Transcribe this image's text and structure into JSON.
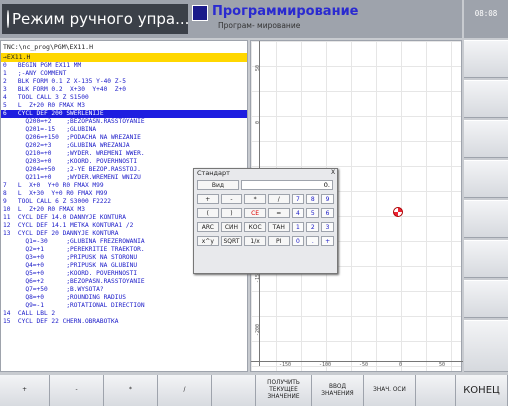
{
  "header": {
    "mode_title": "Режим ручного упра...",
    "prog_title": "Программирование",
    "prog_subtitle": "Програм- мирование",
    "clock": "08:08"
  },
  "program": {
    "path": "TNC:\\nc_prog\\PGM\\EX11.H",
    "file": "→EX11.H",
    "selected_index": 6,
    "lines": [
      "0   BEGIN PGM EX11 MM",
      "1   ;-ANY COMMENT",
      "2   BLK FORM 0.1 Z X-135 Y-40 Z-5",
      "3   BLK FORM 0.2  X+30  Y+40  Z+0",
      "4   TOOL CALL 3 Z S1500",
      "5   L  Z+20 R0 FMAX M3",
      "6   CYCL DEF 200 SWERLENIJE",
      "      Q200=+2    ;BEZOPASN.RASSTOYANIE",
      "      Q201=-15   ;GLUBINA",
      "      Q206=+150  ;PODACHA NA WREZANIE",
      "      Q202=+3    ;GLUBINA WREZANJA",
      "      Q210=+0    ;WYDER. WREMENI WWER.",
      "      Q203=+0    ;KOORD. POVERHNOSTI",
      "      Q204=+50   ;2-YE BEZOP.RASSTOJ.",
      "      Q211=+0    ;WYDER.WREMENI WNIZU",
      "7   L  X+0  Y+0 R0 FMAX M99",
      "8   L  X+30  Y+0 R0 FMAX M99",
      "9   TOOL CALL 6 Z S3000 F2222",
      "10  L  Z+20 R0 FMAX M3",
      "11  CYCL DEF 14.0 DANNYJE KONTURA",
      "12  CYCL DEF 14.1 METKA KONTURA1 /2",
      "13  CYCL DEF 20 DANNYJE KONTURA",
      "      Q1=-30     ;GLUBINA FREZEROWANIA",
      "      Q2=+1      ;PEREKRITIE TRAEKTOR.",
      "      Q3=+0      ;PRIPUSK NA STORONU",
      "      Q4=+0      ;PRIPUSK NA GLUBINU",
      "      Q5=+0      ;KOORD. POVERHNOSTI",
      "      Q6=+2      ;BEZOPASN.RASSTOYANIE",
      "      Q7=+50     ;B.WYSOTA?",
      "      Q8=+0      ;ROUNDING RADIUS",
      "      Q9=-1      ;ROTATIONAL DIRECTION",
      "14  CALL LBL 2",
      "15  CYCL DEF 22 CHERN.OBRABOTKA"
    ]
  },
  "graph": {
    "h_ticks": [
      "-150",
      "-100",
      "-50",
      "0",
      "50"
    ],
    "v_ticks": [
      "50",
      "0",
      "-50",
      "-100",
      "-150",
      "-200"
    ]
  },
  "calculator": {
    "title": "Стандарт",
    "close": "X",
    "view_label": "Вид",
    "display": "0.",
    "rows": [
      [
        "+",
        "-",
        "*",
        "/",
        "7",
        "8",
        "9"
      ],
      [
        "(",
        ")",
        "CE",
        "=",
        "4",
        "5",
        "6"
      ],
      [
        "ARC",
        "СИН",
        "КОС",
        "ТАН",
        "1",
        "2",
        "3"
      ],
      [
        "x^y",
        "SQRT",
        "1/x",
        "PI",
        "0",
        ".",
        "+"
      ]
    ]
  },
  "softkeys": [
    "+",
    "-",
    "*",
    "/",
    "",
    "ПОЛУЧИТЬ ТЕКУЩЕЕ ЗНАЧЕНИЕ",
    "ВВОД ЗНАЧЕНИЯ",
    "ЗНАЧ. ОСИ",
    "",
    "КОНЕЦ"
  ]
}
